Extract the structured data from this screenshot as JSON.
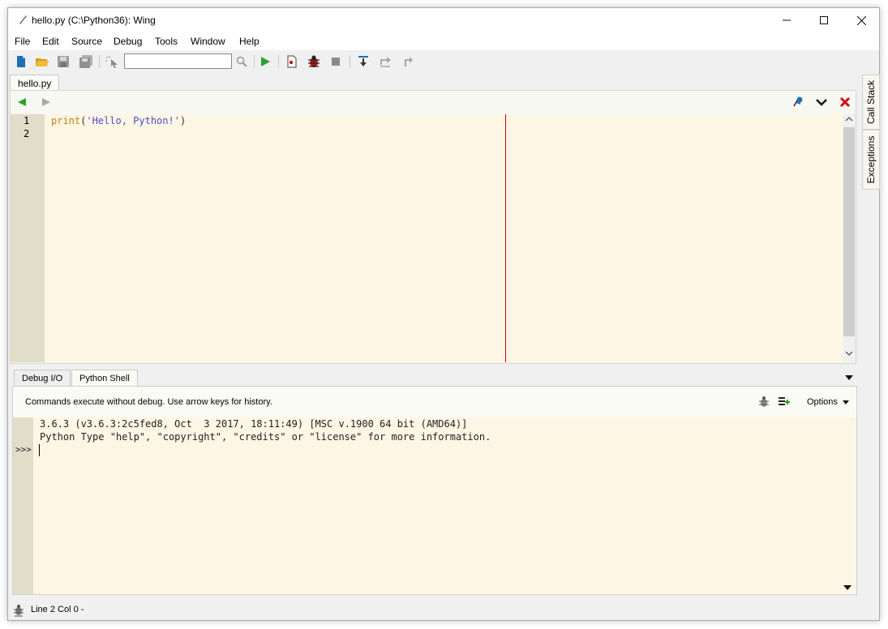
{
  "window": {
    "title": "hello.py (C:\\Python36): Wing"
  },
  "menu": {
    "items": [
      "File",
      "Edit",
      "Source",
      "Debug",
      "Tools",
      "Window",
      "Help"
    ]
  },
  "toolbar": {
    "search_value": ""
  },
  "editor": {
    "tab_label": "hello.py",
    "line_numbers": [
      "1",
      "2"
    ],
    "code": {
      "fn": "print",
      "open": "(",
      "string": "'Hello, Python!'",
      "close": ")"
    }
  },
  "side_tabs": [
    "Call Stack",
    "Exceptions"
  ],
  "bottom": {
    "tabs": [
      "Debug I/O",
      "Python Shell"
    ],
    "active_tab": "Python Shell",
    "hint": "Commands execute without debug.  Use arrow keys for history.",
    "options_label": "Options",
    "shell_lines": [
      "3.6.3 (v3.6.3:2c5fed8, Oct  3 2017, 18:11:49) [MSC v.1900 64 bit (AMD64)]",
      "Python Type \"help\", \"copyright\", \"credits\" or \"license\" for more information."
    ],
    "prompt": ">>>"
  },
  "status": {
    "text": "Line 2 Col 0 -"
  },
  "colors": {
    "code_bg": "#fdf6e4",
    "gutter_bg": "#e2ddc9",
    "edge_line": "#cc0000",
    "run_green": "#2e9e2e",
    "close_red": "#cc1111"
  }
}
